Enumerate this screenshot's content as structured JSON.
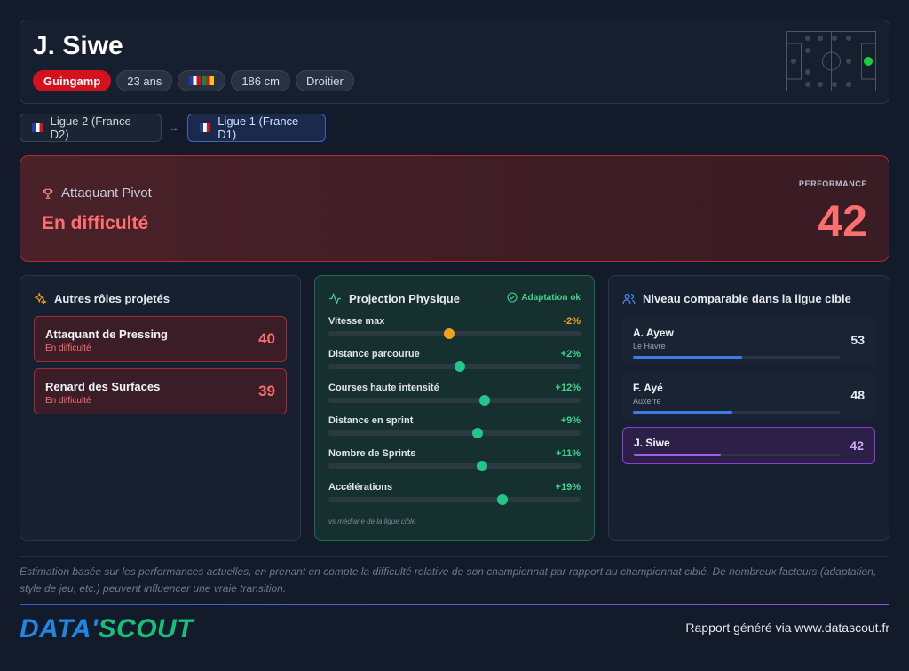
{
  "player": {
    "name": "J. Siwe",
    "club": "Guingamp",
    "age": "23 ans",
    "height": "186 cm",
    "foot": "Droitier",
    "nationality_flags": [
      "flag-fr",
      "flag-cm"
    ]
  },
  "leagues": {
    "from": "Ligue 2 (France D2)",
    "arrow": "→",
    "to": "Ligue 1 (France D1)"
  },
  "main_role": {
    "title": "Attaquant Pivot",
    "status": "En difficulté",
    "performance_label": "PERFORMANCE",
    "score": "42"
  },
  "other_roles": {
    "title": "Autres rôles projetés",
    "items": [
      {
        "name": "Attaquant de Pressing",
        "status": "En difficulté",
        "score": "40"
      },
      {
        "name": "Renard des Surfaces",
        "status": "En difficulté",
        "score": "39"
      }
    ]
  },
  "physical": {
    "title": "Projection Physique",
    "badge": "Adaptation ok",
    "note": "vs médiane de la ligue cible",
    "metrics": [
      {
        "label": "Vitesse max",
        "delta": "-2%",
        "position": 0.48,
        "color": "#f0a11d"
      },
      {
        "label": "Distance parcourue",
        "delta": "+2%",
        "position": 0.52,
        "color": "#22c68a"
      },
      {
        "label": "Courses haute intensité",
        "delta": "+12%",
        "position": 0.62,
        "color": "#22c68a"
      },
      {
        "label": "Distance en sprint",
        "delta": "+9%",
        "position": 0.59,
        "color": "#22c68a"
      },
      {
        "label": "Nombre de Sprints",
        "delta": "+11%",
        "position": 0.61,
        "color": "#22c68a"
      },
      {
        "label": "Accélérations",
        "delta": "+19%",
        "position": 0.69,
        "color": "#22c68a"
      }
    ]
  },
  "comparable": {
    "title": "Niveau comparable dans la ligue cible",
    "players": [
      {
        "name": "A. Ayew",
        "club": "Le Havre",
        "score": "53",
        "fill": 0.53,
        "color": "#3b7ce6"
      },
      {
        "name": "F. Ayé",
        "club": "Auxerre",
        "score": "48",
        "fill": 0.48,
        "color": "#3b7ce6"
      },
      {
        "name": "J. Siwe",
        "club": "",
        "score": "42",
        "fill": 0.42,
        "color": "#a45de8"
      }
    ]
  },
  "footer": {
    "disclaimer": "Estimation basée sur les performances actuelles, en prenant en compte la difficulté relative de son championnat par rapport au championnat ciblé. De nombreux facteurs (adaptation, style de jeu, etc.) peuvent influencer une vraie transition.",
    "brand_part1": "DATA'",
    "brand_part2": "SCOUT",
    "generated": "Rapport généré via www.datascout.fr"
  },
  "colors": {
    "danger": "#ff6f6f",
    "success": "#3fd58f",
    "club_red": "#d3121d"
  }
}
